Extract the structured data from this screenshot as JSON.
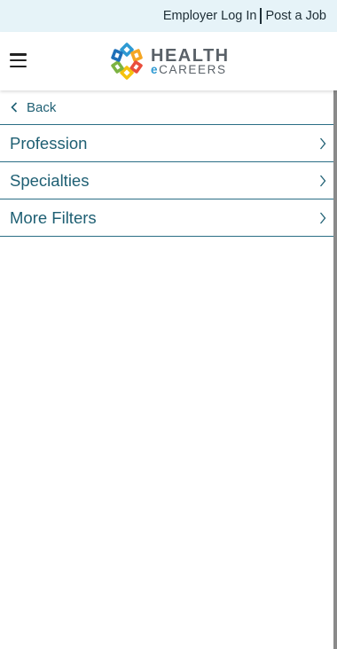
{
  "topbar": {
    "employer_login": "Employer Log In",
    "post_job": "Post a Job"
  },
  "logo": {
    "line1": "HEALTH",
    "line2_e": "e",
    "line2_rest": "CAREERS",
    "colors": [
      "#f5a623",
      "#2e9ad3",
      "#e94e3c",
      "#7cb342",
      "#1e6fb8",
      "#f4c20d"
    ]
  },
  "filters": {
    "back_label": "Back",
    "items": [
      {
        "label": "Profession"
      },
      {
        "label": "Specialties"
      },
      {
        "label": "More Filters"
      }
    ]
  },
  "colors": {
    "accent": "#1e5f73",
    "divider": "#2a6e85",
    "topbar_bg": "#e6f3f8"
  }
}
